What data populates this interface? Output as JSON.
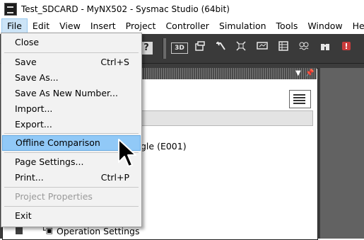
{
  "window": {
    "title": "Test_SDCARD - MyNX502 - Sysmac Studio (64bit)",
    "icon": "sysmac-app-icon"
  },
  "menubar": {
    "items": [
      "File",
      "Edit",
      "View",
      "Insert",
      "Project",
      "Controller",
      "Simulation",
      "Tools",
      "Window",
      "Help"
    ],
    "active": "File"
  },
  "file_menu": {
    "items": [
      {
        "label": "Close",
        "shortcut": ""
      },
      {
        "label": "Save",
        "shortcut": "Ctrl+S"
      },
      {
        "label": "Save As...",
        "shortcut": ""
      },
      {
        "label": "Save As New Number...",
        "shortcut": ""
      },
      {
        "label": "Import...",
        "shortcut": ""
      },
      {
        "label": "Export...",
        "shortcut": ""
      },
      {
        "label": "Offline Comparison",
        "shortcut": "",
        "highlighted": true
      },
      {
        "label": "Page Settings...",
        "shortcut": ""
      },
      {
        "label": "Print...",
        "shortcut": "Ctrl+P"
      },
      {
        "label": "Project Properties",
        "shortcut": "",
        "disabled": true
      },
      {
        "label": "Exit",
        "shortcut": ""
      }
    ]
  },
  "toolbar": {
    "icons": [
      "help-icon",
      "3d-simulation-icon",
      "data-trace-icon",
      "build-icon",
      "network-icon",
      "monitor-icon",
      "data-log-icon",
      "watch-icon",
      "binoculars-icon",
      "record-icon"
    ],
    "labels": {
      "help": "?",
      "three_d": "3D"
    }
  },
  "tree": {
    "partial_item": "gle (E001)",
    "operation_settings": "Operation Settings"
  },
  "colors": {
    "menu_highlight": "#91c9f7",
    "toolbar_bg": "#3a3a3a",
    "menubar_active": "#cce4f7"
  }
}
